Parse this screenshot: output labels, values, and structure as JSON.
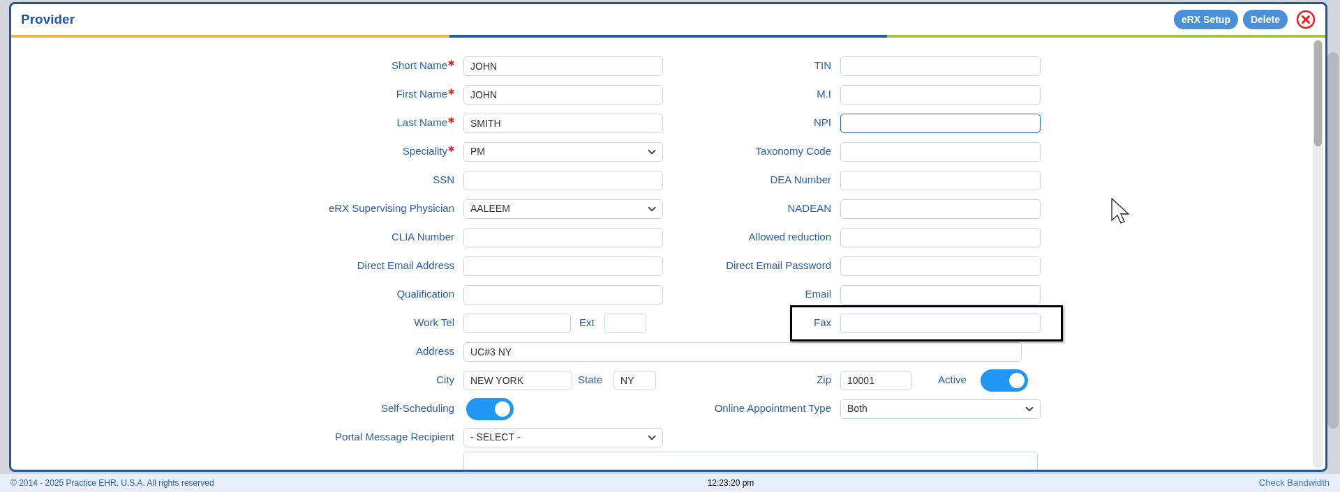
{
  "dialog": {
    "title": "Provider",
    "buttons": [
      "eRX Setup",
      "Delete"
    ]
  },
  "form": {
    "rows": [
      {
        "kind": "pair",
        "highlighted": false,
        "left": {
          "kind": "text",
          "label": "Short Name",
          "required": true,
          "focused": false,
          "value": "JOHN"
        },
        "right": {
          "kind": "text",
          "label": "TIN",
          "required": false,
          "focused": false
        }
      },
      {
        "kind": "pair",
        "highlighted": false,
        "left": {
          "kind": "text",
          "label": "First Name",
          "required": true,
          "focused": false,
          "value": "JOHN"
        },
        "right": {
          "kind": "text",
          "label": "M.I",
          "required": false,
          "focused": false
        }
      },
      {
        "kind": "pair",
        "highlighted": false,
        "left": {
          "kind": "text",
          "label": "Last Name",
          "required": true,
          "focused": false,
          "value": "SMITH"
        },
        "right": {
          "kind": "text",
          "label": "NPI",
          "required": false,
          "focused": true
        }
      },
      {
        "kind": "pair",
        "highlighted": false,
        "left": {
          "kind": "select",
          "label": "Speciality",
          "required": true,
          "focused": false,
          "value": "PM"
        },
        "right": {
          "kind": "text",
          "label": "Taxonomy Code",
          "required": false,
          "focused": false
        }
      },
      {
        "kind": "pair",
        "highlighted": false,
        "left": {
          "kind": "text",
          "label": "SSN",
          "required": false,
          "focused": false
        },
        "right": {
          "kind": "text",
          "label": "DEA Number",
          "required": false,
          "focused": false
        }
      },
      {
        "kind": "pair",
        "highlighted": false,
        "left": {
          "kind": "select",
          "label": "eRX Supervising Physician",
          "required": false,
          "focused": false,
          "value": "AALEEM"
        },
        "right": {
          "kind": "text",
          "label": "NADEAN",
          "required": false,
          "focused": false
        }
      },
      {
        "kind": "pair",
        "highlighted": false,
        "left": {
          "kind": "text",
          "label": "CLIA Number",
          "required": false,
          "focused": false
        },
        "right": {
          "kind": "text",
          "label": "Allowed reduction",
          "required": false,
          "focused": false
        }
      },
      {
        "kind": "pair",
        "highlighted": false,
        "left": {
          "kind": "text",
          "label": "Direct Email Address",
          "required": false,
          "focused": false
        },
        "right": {
          "kind": "text",
          "label": "Direct Email Password",
          "required": false,
          "focused": false
        }
      },
      {
        "kind": "pair",
        "highlighted": false,
        "left": {
          "kind": "text",
          "label": "Qualification",
          "required": false,
          "focused": false
        },
        "right": {
          "kind": "text",
          "label": "Email",
          "required": false,
          "focused": false
        }
      },
      {
        "kind": "phone",
        "highlighted": true,
        "left": {
          "kind": "text",
          "label": "Work Tel",
          "required": false,
          "focused": false
        },
        "extra": {
          "kind": "text",
          "label": "Ext",
          "required": false,
          "focused": false
        },
        "right": {
          "kind": "text",
          "label": "Fax",
          "required": false,
          "focused": false
        }
      },
      {
        "kind": "address",
        "highlighted": false,
        "left": {
          "kind": "text",
          "label": "Address",
          "required": false,
          "focused": false,
          "value": "UC#3 NY"
        }
      },
      {
        "kind": "city",
        "highlighted": false,
        "left": {
          "kind": "text",
          "label": "City",
          "required": false,
          "focused": false,
          "value": "NEW YORK"
        },
        "extra": {
          "kind": "text",
          "label": "State",
          "required": false,
          "focused": false,
          "value": "NY"
        },
        "right": {
          "kind": "text",
          "label": "Zip",
          "required": false,
          "focused": false,
          "value": "10001"
        },
        "toggle": {
          "kind": "toggle",
          "label": "Active",
          "on": true
        }
      },
      {
        "kind": "scheduling",
        "highlighted": false,
        "left": {
          "kind": "toggle",
          "label": "Self-Scheduling",
          "on": true
        },
        "right": {
          "kind": "select",
          "label": "Online Appointment Type",
          "required": false,
          "focused": false,
          "value": "Both"
        }
      },
      {
        "kind": "single",
        "highlighted": false,
        "left": {
          "kind": "select",
          "label": "Portal Message Recipient",
          "required": false,
          "focused": false,
          "value": "- SELECT -"
        }
      },
      {
        "kind": "notes",
        "highlighted": false
      }
    ]
  },
  "footer": {
    "copyright": "© 2014 - 2025 Practice EHR, U.S.A. All rights reserved",
    "time": "12:23:20 pm",
    "link": "Check Bandwidth"
  }
}
